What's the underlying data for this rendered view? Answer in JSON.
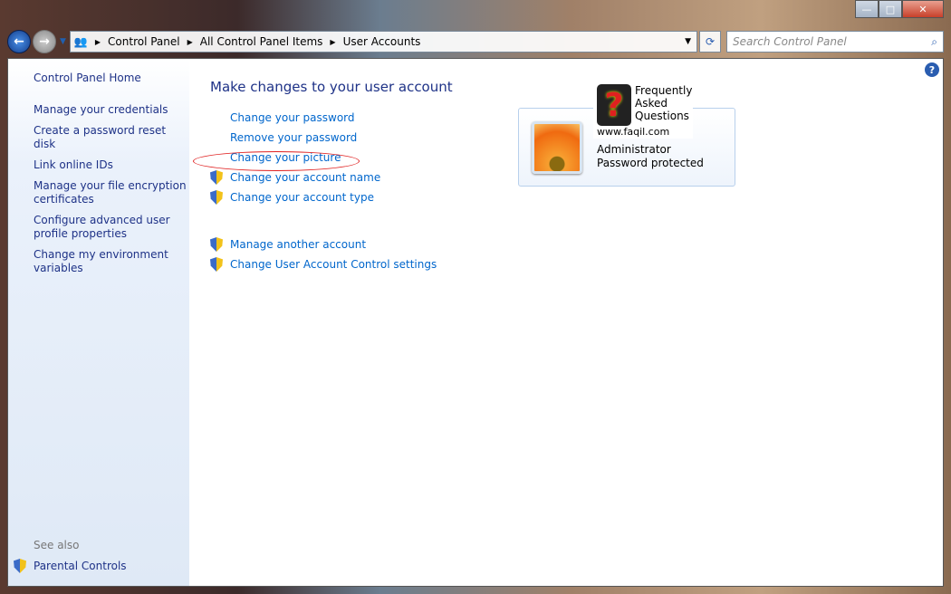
{
  "window": {
    "minimize": "—",
    "maximize": "□",
    "close": "✕"
  },
  "breadcrumb": [
    "Control Panel",
    "All Control Panel Items",
    "User Accounts"
  ],
  "search": {
    "placeholder": "Search Control Panel"
  },
  "sidebar": {
    "home": "Control Panel Home",
    "items": [
      "Manage your credentials",
      "Create a password reset disk",
      "Link online IDs",
      "Manage your file encryption certificates",
      "Configure advanced user profile properties",
      "Change my environment variables"
    ],
    "see_also": "See also",
    "parental": "Parental Controls"
  },
  "main": {
    "title": "Make changes to your user account",
    "tasks": [
      {
        "label": "Change your password",
        "shield": false
      },
      {
        "label": "Remove your password",
        "shield": false
      },
      {
        "label": "Change your picture",
        "shield": false
      },
      {
        "label": "Change your account name",
        "shield": true
      },
      {
        "label": "Change your account type",
        "shield": true
      }
    ],
    "other_tasks": [
      {
        "label": "Manage another account",
        "shield": true
      },
      {
        "label": "Change User Account Control settings",
        "shield": true
      }
    ]
  },
  "account": {
    "name": "Administrator",
    "status": "Password protected"
  },
  "watermark": {
    "text": [
      "Frequently",
      "Asked",
      "Questions"
    ],
    "url": "www.faqil.com"
  },
  "colors": {
    "link": "#0066cc",
    "nav_link": "#1e3287",
    "highlight_circle": "#e02020"
  }
}
